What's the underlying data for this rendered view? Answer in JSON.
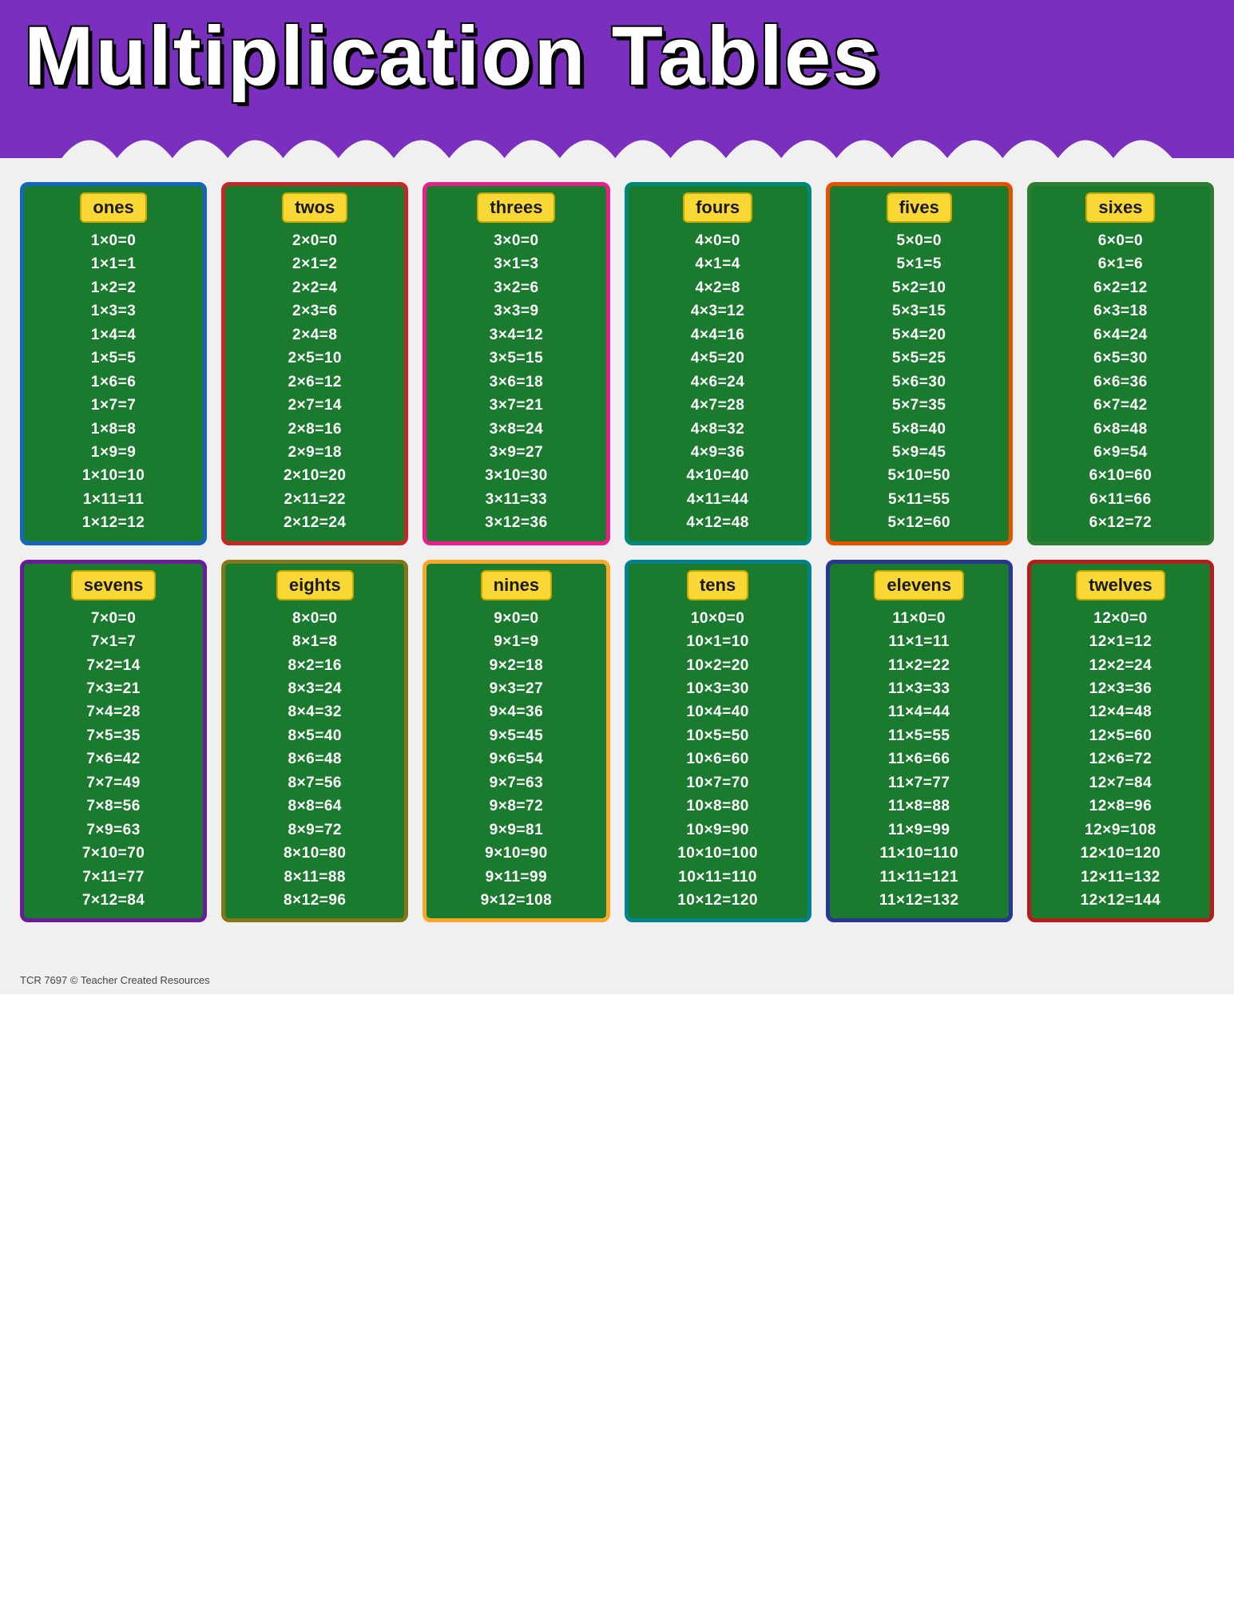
{
  "title": "Multiplication Tables",
  "footer": "TCR 7697  © Teacher Created Resources",
  "tables": [
    {
      "id": "ones",
      "label": "ones",
      "border": "blue-border",
      "equations": [
        "1×0=0",
        "1×1=1",
        "1×2=2",
        "1×3=3",
        "1×4=4",
        "1×5=5",
        "1×6=6",
        "1×7=7",
        "1×8=8",
        "1×9=9",
        "1×10=10",
        "1×11=11",
        "1×12=12"
      ]
    },
    {
      "id": "twos",
      "label": "twos",
      "border": "red-border",
      "equations": [
        "2×0=0",
        "2×1=2",
        "2×2=4",
        "2×3=6",
        "2×4=8",
        "2×5=10",
        "2×6=12",
        "2×7=14",
        "2×8=16",
        "2×9=18",
        "2×10=20",
        "2×11=22",
        "2×12=24"
      ]
    },
    {
      "id": "threes",
      "label": "threes",
      "border": "pink-border",
      "equations": [
        "3×0=0",
        "3×1=3",
        "3×2=6",
        "3×3=9",
        "3×4=12",
        "3×5=15",
        "3×6=18",
        "3×7=21",
        "3×8=24",
        "3×9=27",
        "3×10=30",
        "3×11=33",
        "3×12=36"
      ]
    },
    {
      "id": "fours",
      "label": "fours",
      "border": "teal-border",
      "equations": [
        "4×0=0",
        "4×1=4",
        "4×2=8",
        "4×3=12",
        "4×4=16",
        "4×5=20",
        "4×6=24",
        "4×7=28",
        "4×8=32",
        "4×9=36",
        "4×10=40",
        "4×11=44",
        "4×12=48"
      ]
    },
    {
      "id": "fives",
      "label": "fives",
      "border": "orange-border",
      "equations": [
        "5×0=0",
        "5×1=5",
        "5×2=10",
        "5×3=15",
        "5×4=20",
        "5×5=25",
        "5×6=30",
        "5×7=35",
        "5×8=40",
        "5×9=45",
        "5×10=50",
        "5×11=55",
        "5×12=60"
      ]
    },
    {
      "id": "sixes",
      "label": "sixes",
      "border": "green-border",
      "equations": [
        "6×0=0",
        "6×1=6",
        "6×2=12",
        "6×3=18",
        "6×4=24",
        "6×5=30",
        "6×6=36",
        "6×7=42",
        "6×8=48",
        "6×9=54",
        "6×10=60",
        "6×11=66",
        "6×12=72"
      ]
    },
    {
      "id": "sevens",
      "label": "sevens",
      "border": "purple-border",
      "equations": [
        "7×0=0",
        "7×1=7",
        "7×2=14",
        "7×3=21",
        "7×4=28",
        "7×5=35",
        "7×6=42",
        "7×7=49",
        "7×8=56",
        "7×9=63",
        "7×10=70",
        "7×11=77",
        "7×12=84"
      ]
    },
    {
      "id": "eights",
      "label": "eights",
      "border": "lime-border",
      "equations": [
        "8×0=0",
        "8×1=8",
        "8×2=16",
        "8×3=24",
        "8×4=32",
        "8×5=40",
        "8×6=48",
        "8×7=56",
        "8×8=64",
        "8×9=72",
        "8×10=80",
        "8×11=88",
        "8×12=96"
      ]
    },
    {
      "id": "nines",
      "label": "nines",
      "border": "yellow-border",
      "equations": [
        "9×0=0",
        "9×1=9",
        "9×2=18",
        "9×3=27",
        "9×4=36",
        "9×5=45",
        "9×6=54",
        "9×7=63",
        "9×8=72",
        "9×9=81",
        "9×10=90",
        "9×11=99",
        "9×12=108"
      ]
    },
    {
      "id": "tens",
      "label": "tens",
      "border": "cyan-border",
      "equations": [
        "10×0=0",
        "10×1=10",
        "10×2=20",
        "10×3=30",
        "10×4=40",
        "10×5=50",
        "10×6=60",
        "10×7=70",
        "10×8=80",
        "10×9=90",
        "10×10=100",
        "10×11=110",
        "10×12=120"
      ]
    },
    {
      "id": "elevens",
      "label": "elevens",
      "border": "indigo-border",
      "equations": [
        "11×0=0",
        "11×1=11",
        "11×2=22",
        "11×3=33",
        "11×4=44",
        "11×5=55",
        "11×6=66",
        "11×7=77",
        "11×8=88",
        "11×9=99",
        "11×10=110",
        "11×11=121",
        "11×12=132"
      ]
    },
    {
      "id": "twelves",
      "label": "twelves",
      "border": "darkred-border",
      "equations": [
        "12×0=0",
        "12×1=12",
        "12×2=24",
        "12×3=36",
        "12×4=48",
        "12×5=60",
        "12×6=72",
        "12×7=84",
        "12×8=96",
        "12×9=108",
        "12×10=120",
        "12×11=132",
        "12×12=144"
      ]
    }
  ]
}
